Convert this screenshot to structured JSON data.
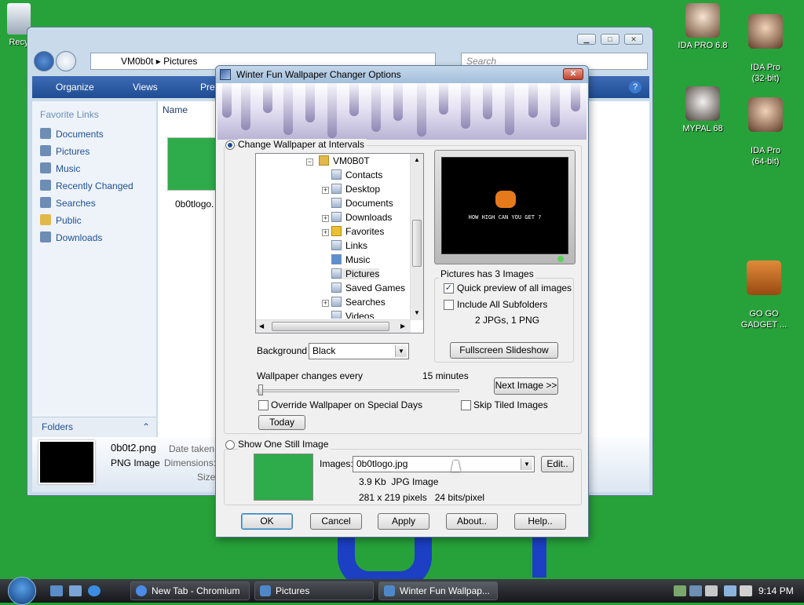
{
  "desktop": {
    "icons": {
      "recycle": "Recy",
      "ida68": "IDA PRO 6.8",
      "ida32": "IDA Pro\n(32-bit)",
      "mypal": "MYPAL 68",
      "ida64": "IDA Pro\n(64-bit)",
      "gogo": "GO GO\nGADGET ..."
    }
  },
  "explorer": {
    "breadcrumb": [
      "VM0b0t",
      "Pictures"
    ],
    "search_placeholder": "Search",
    "toolbar": {
      "organize": "Organize",
      "views": "Views",
      "preview": "Prev"
    },
    "column_name": "Name",
    "favorite_links_title": "Favorite Links",
    "favorite_links": [
      "Documents",
      "Pictures",
      "Music",
      "Recently Changed",
      "Searches",
      "Public",
      "Downloads"
    ],
    "file_item": "0b0tlogo.",
    "folders_label": "Folders",
    "details": {
      "filename": "0b0t2.png",
      "filetype": "PNG Image",
      "date_taken_label": "Date taken:",
      "dimensions_label": "Dimensions:",
      "size_label": "Size:"
    }
  },
  "dialog": {
    "title": "Winter Fun Wallpaper Changer Options",
    "intervals_radio": "Change Wallpaper at Intervals",
    "tree": {
      "root": "VM0B0T",
      "items": [
        "Contacts",
        "Desktop",
        "Documents",
        "Downloads",
        "Favorites",
        "Links",
        "Music",
        "Pictures",
        "Saved Games",
        "Searches",
        "Videos"
      ]
    },
    "preview_caption": "HOW HIGH CAN YOU GET ?",
    "folder_info": "Pictures has 3 Images",
    "quick_preview": "Quick preview of all images",
    "include_subfolders": "Include All Subfolders",
    "file_counts": "2 JPGs, 1 PNG",
    "fullscreen_button": "Fullscreen Slideshow",
    "background_label": "Background",
    "background_value": "Black",
    "changes_every_label": "Wallpaper changes every",
    "interval_value": "15 minutes",
    "next_image_button": "Next Image >>",
    "override_special": "Override Wallpaper on Special Days",
    "skip_tiled": "Skip Tiled Images",
    "today_button": "Today",
    "still_image_radio": "Show One Still Image",
    "images_label": "Images:",
    "images_value": "0b0tlogo.jpg",
    "edit_button": "Edit..",
    "image_info_1": "3.9 Kb  JPG Image",
    "image_info_2": "281 x 219 pixels   24 bits/pixel",
    "buttons": {
      "ok": "OK",
      "cancel": "Cancel",
      "apply": "Apply",
      "about": "About..",
      "help": "Help.."
    },
    "quick_preview_checked": true,
    "include_subfolders_checked": false,
    "override_checked": false,
    "skip_tiled_checked": false
  },
  "taskbar": {
    "tasks": [
      "New Tab - Chromium",
      "Pictures",
      "Winter Fun Wallpap..."
    ],
    "clock": "9:14 PM"
  },
  "colors": {
    "desktop_bg": "#27a23a",
    "taskbar": "#1e2024",
    "accent": "#1f4f96"
  }
}
